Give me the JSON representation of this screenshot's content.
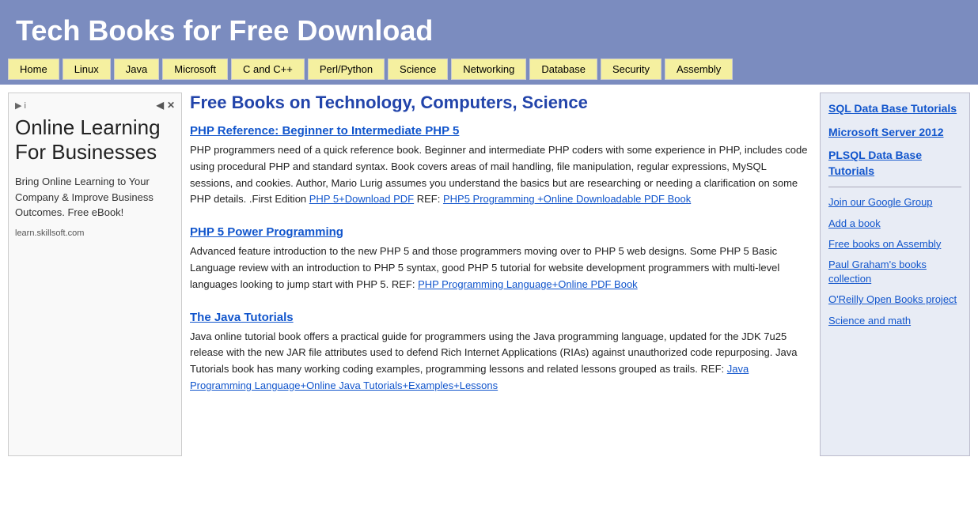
{
  "header": {
    "title": "Tech Books for Free Download"
  },
  "nav": {
    "items": [
      {
        "label": "Home",
        "id": "home"
      },
      {
        "label": "Linux",
        "id": "linux"
      },
      {
        "label": "Java",
        "id": "java"
      },
      {
        "label": "Microsoft",
        "id": "microsoft"
      },
      {
        "label": "C and C++",
        "id": "c-cpp"
      },
      {
        "label": "Perl/Python",
        "id": "perl-python"
      },
      {
        "label": "Science",
        "id": "science"
      },
      {
        "label": "Networking",
        "id": "networking"
      },
      {
        "label": "Database",
        "id": "database"
      },
      {
        "label": "Security",
        "id": "security"
      },
      {
        "label": "Assembly",
        "id": "assembly"
      }
    ]
  },
  "ad": {
    "headline": "Online Learning For Businesses",
    "body": "Bring Online Learning to Your Company & Improve Business Outcomes. Free eBook!",
    "footer": "learn.skillsoft.com"
  },
  "main": {
    "heading": "Free Books on Technology, Computers, Science",
    "books": [
      {
        "title": "PHP Reference: Beginner to Intermediate PHP 5",
        "description": "PHP programmers need of a quick reference book. Beginner and intermediate PHP coders with some experience in PHP, includes code using procedural PHP and standard syntax. Book covers areas of mail handling, file manipulation, regular expressions, MySQL sessions, and cookies. Author, Mario Lurig assumes you understand the basics but are researching or needing a clarification on some PHP details. .First Edition",
        "links": [
          {
            "text": "PHP 5+Download PDF",
            "href": "#"
          },
          {
            "text": "PHP5 Programming +Online Downloadable PDF Book",
            "href": "#"
          }
        ],
        "link_prefix": " REF: ",
        "link_sep": " REF: "
      },
      {
        "title": "PHP 5 Power Programming",
        "description": "Advanced feature introduction to the new PHP 5 and those programmers moving over to PHP 5 web designs. Some PHP 5 Basic Language review with an introduction to PHP 5 syntax, good PHP 5 tutorial for website development programmers with multi-level languages looking to jump start with PHP 5. REF:",
        "links": [
          {
            "text": "PHP Programming Language+Online PDF Book",
            "href": "#"
          }
        ]
      },
      {
        "title": "The Java Tutorials",
        "description": "Java online tutorial book offers a practical guide for programmers using the Java programming language, updated for the JDK 7u25 release with the new JAR file attributes used to defend Rich Internet Applications (RIAs) against unauthorized code repurposing. Java Tutorials book has many working coding examples, programming lessons and related lessons grouped as trails. REF:",
        "links": [
          {
            "text": "Java Programming Language+Online Java Tutorials+Examples+Lessons",
            "href": "#"
          }
        ]
      }
    ]
  },
  "right_sidebar": {
    "main_links": [
      {
        "text": "SQL Data Base Tutorials",
        "id": "sql-db"
      },
      {
        "text": "Microsoft Server 2012",
        "id": "ms-server"
      },
      {
        "text": "PLSQL Data Base Tutorials",
        "id": "plsql"
      }
    ],
    "sub_links": [
      {
        "text": "Join our Google Group",
        "id": "google-group"
      },
      {
        "text": "Add a book",
        "id": "add-book"
      },
      {
        "text": "Free books on Assembly",
        "id": "free-assembly"
      },
      {
        "text": "Paul Graham's books collection",
        "id": "paul-graham"
      },
      {
        "text": "O'Reilly Open Books project",
        "id": "oreilly"
      },
      {
        "text": "Science and math",
        "id": "science-math"
      }
    ]
  }
}
